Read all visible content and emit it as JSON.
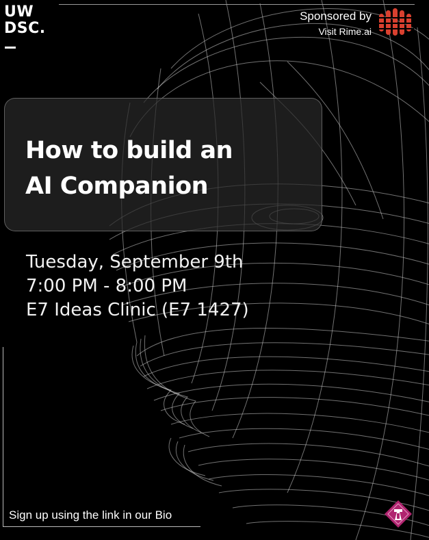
{
  "logo": {
    "line1": "UW",
    "line2": "DSC."
  },
  "sponsor": {
    "label": "Sponsored by",
    "link_text": "Visit Rime.ai",
    "logo_icon": "rime-logo-icon",
    "logo_color": "#d9402f"
  },
  "event": {
    "title_line1": "How to build an",
    "title_line2": "AI Companion",
    "date": "Tuesday, September 9th",
    "time": "7:00 PM - 8:00 PM",
    "location": "E7 Ideas Clinic (E7 1427)"
  },
  "footer": {
    "signup_text": "Sign up using the link in our Bio",
    "badge_icon": "diamond-badge-icon",
    "badge_color": "#b0246f"
  },
  "colors": {
    "background": "#000000",
    "text": "#ffffff",
    "card": "#282828",
    "wireframe": "#cfcfcf"
  }
}
